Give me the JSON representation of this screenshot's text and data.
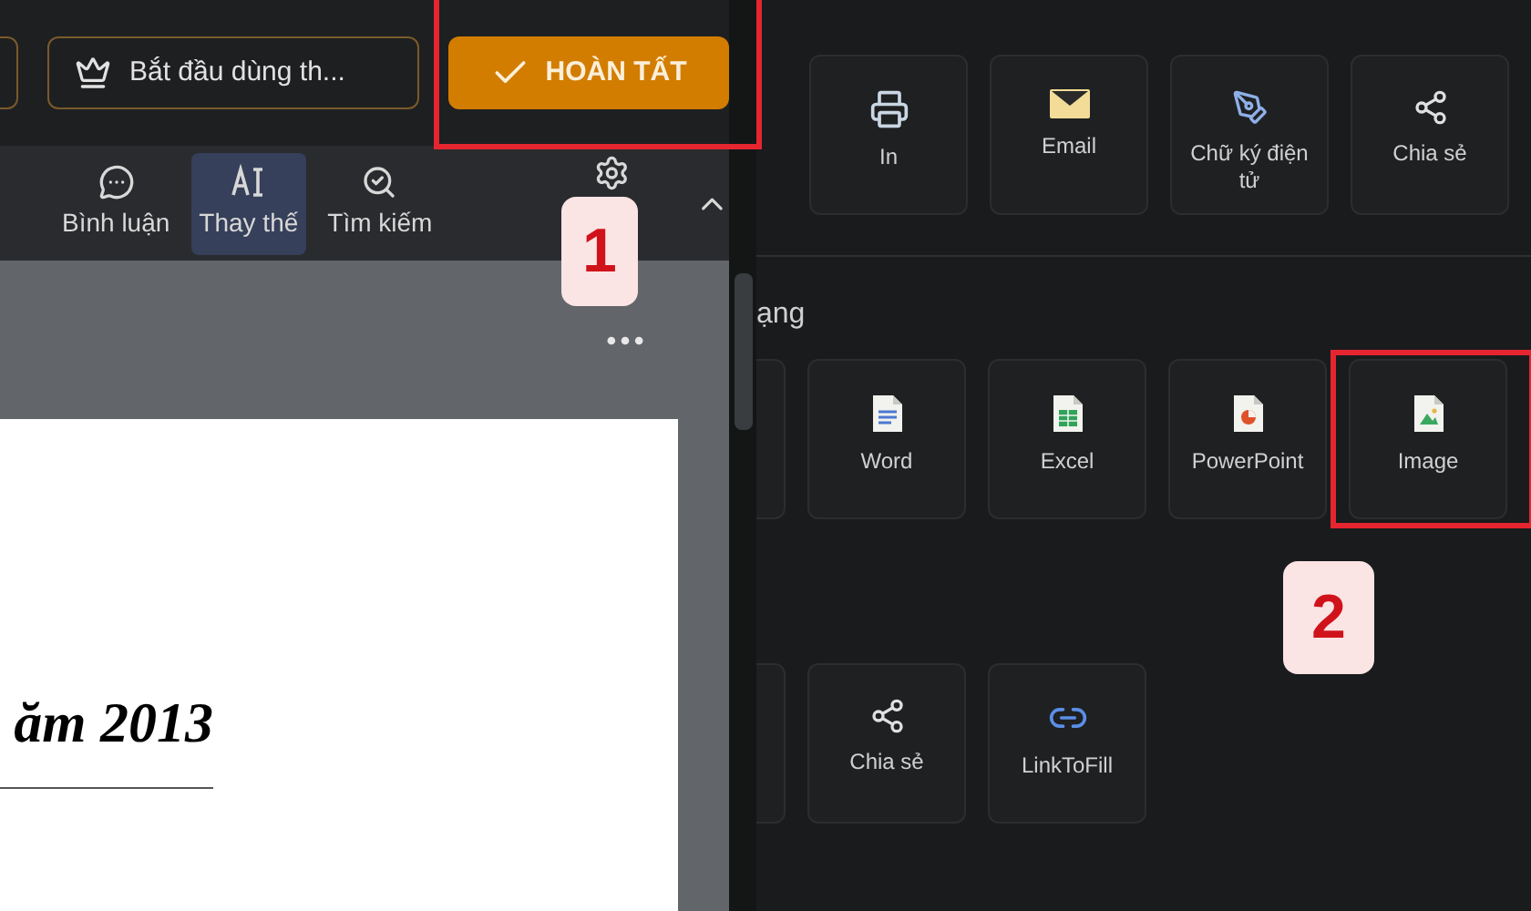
{
  "header": {
    "trial_button": "Bắt đầu dùng th...",
    "done_button": "HOÀN TẤT"
  },
  "toolbar": [
    {
      "label": "Bình luận",
      "kind": "comment",
      "selected": false
    },
    {
      "label": "Thay thế",
      "kind": "replace",
      "selected": true
    },
    {
      "label": "Tìm kiếm",
      "kind": "search",
      "selected": false
    }
  ],
  "document": {
    "text": "ăm 2013"
  },
  "share_actions": [
    {
      "label": "In",
      "kind": "print"
    },
    {
      "label": "Email",
      "kind": "email"
    },
    {
      "label": "Chữ ký điện tử",
      "kind": "signature"
    },
    {
      "label": "Chia sẻ",
      "kind": "share"
    }
  ],
  "format_section": {
    "heading": "ạng",
    "formats": [
      {
        "label": "Word",
        "kind": "word"
      },
      {
        "label": "Excel",
        "kind": "excel"
      },
      {
        "label": "PowerPoint",
        "kind": "powerpoint"
      },
      {
        "label": "Image",
        "kind": "image"
      }
    ]
  },
  "more_actions": [
    {
      "label": "Chia sẻ",
      "kind": "share"
    },
    {
      "label": "LinkToFill",
      "kind": "link"
    }
  ],
  "callouts": [
    "1",
    "2"
  ]
}
